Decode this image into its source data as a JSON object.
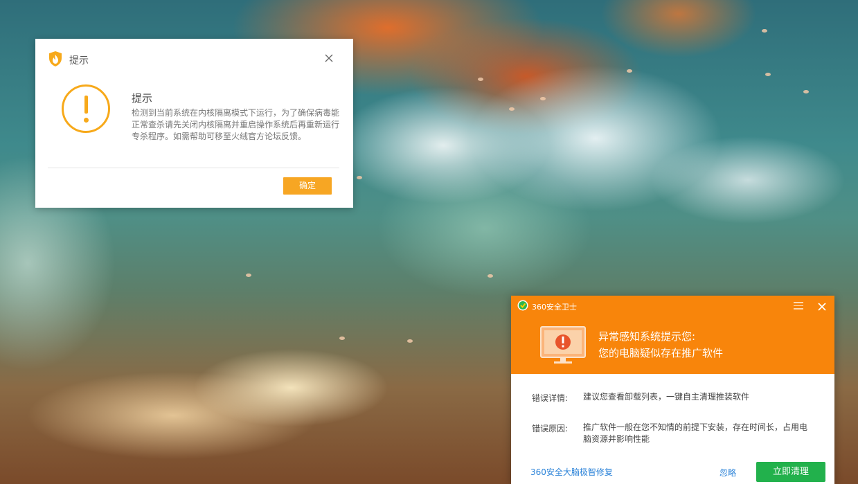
{
  "wallpaper": {
    "description_icon": "forest-wallpaper"
  },
  "notice_dialog": {
    "window_title": "提示",
    "heading": "提示",
    "message": "检测到当前系统在内核隔离模式下运行，为了确保病毒能正常查杀请先关闭内核隔离并重启操作系统后再重新运行专杀程序。如需帮助可移至火绒官方论坛反馈。",
    "ok_label": "确定",
    "icons": {
      "title": "shield-flame-icon",
      "close": "close-icon",
      "warning": "exclamation-warning-icon"
    },
    "accent_color": "#f7a91a"
  },
  "security_popup": {
    "app_name": "360安全卫士",
    "alert_title": "异常感知系统提示您:",
    "alert_subtitle": "您的电脑疑似存在推广软件",
    "details": [
      {
        "label": "错误详情:",
        "value": "建议您查看卸载列表，一键自主清理推装软件"
      },
      {
        "label": "错误原因:",
        "value": "推广软件一般在您不知情的前提下安装，存在时间长，占用电脑资源并影响性能"
      }
    ],
    "repair_link": "360安全大脑极智修复",
    "ignore_label": "忽略",
    "clean_label": "立即清理",
    "icons": {
      "logo": "360-logo-icon",
      "menu": "menu-icon",
      "close": "close-icon",
      "monitor": "monitor-warning-icon"
    },
    "header_color": "#f8850b",
    "button_color": "#22b14c"
  }
}
